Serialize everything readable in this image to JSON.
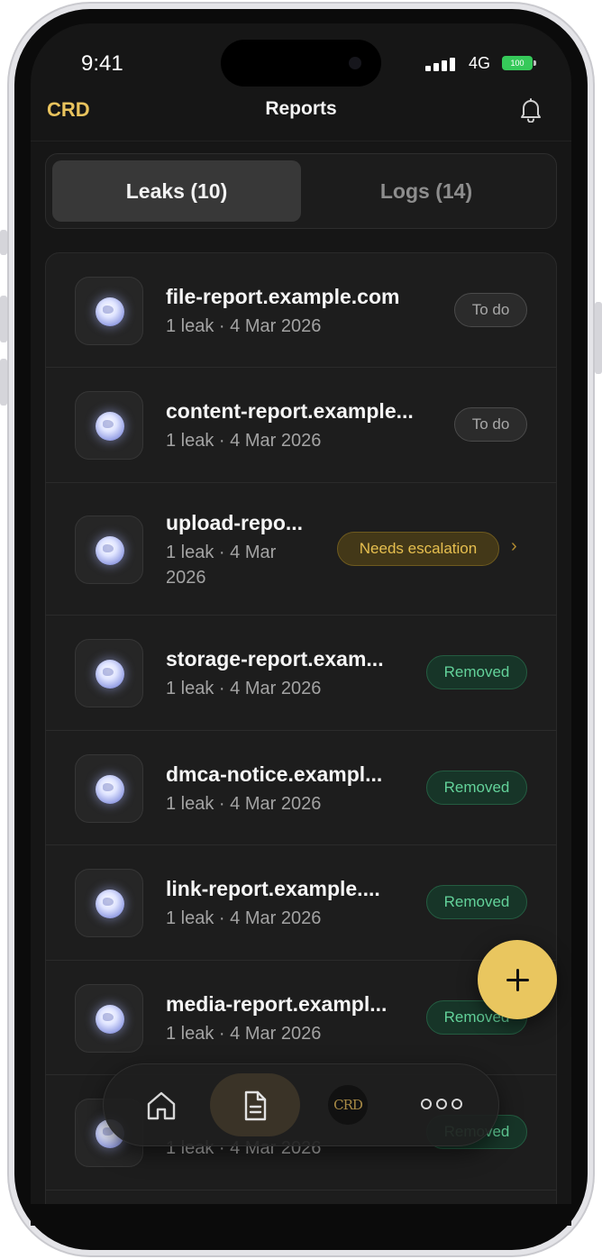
{
  "status": {
    "time": "9:41",
    "network": "4G",
    "battery": "100"
  },
  "header": {
    "brand": "CRD",
    "title": "Reports"
  },
  "tabs": [
    {
      "label": "Leaks (10)",
      "active": true
    },
    {
      "label": "Logs (14)",
      "active": false
    }
  ],
  "reports": [
    {
      "title": "file-report.example.com",
      "sub": "1 leak · 4 Mar 2026",
      "status": "To do"
    },
    {
      "title": "content-report.example...",
      "sub": "1 leak · 4 Mar 2026",
      "status": "To do"
    },
    {
      "title": "upload-repo...",
      "sub": "1 leak · 4 Mar 2026",
      "status": "Needs escalation"
    },
    {
      "title": "storage-report.exam...",
      "sub": "1 leak · 4 Mar 2026",
      "status": "Removed"
    },
    {
      "title": "dmca-notice.exampl...",
      "sub": "1 leak · 4 Mar 2026",
      "status": "Removed"
    },
    {
      "title": "link-report.example....",
      "sub": "1 leak · 4 Mar 2026",
      "status": "Removed"
    },
    {
      "title": "media-report.exampl...",
      "sub": "1 leak · 4 Mar 2026",
      "status": "Removed"
    },
    {
      "title": "",
      "sub": "1 leak · 4 Mar 2026",
      "status": "Removed"
    }
  ],
  "fab": {
    "icon": "plus-icon"
  },
  "tabbar": {
    "items": [
      {
        "icon": "home-icon",
        "active": false
      },
      {
        "icon": "document-icon",
        "active": true
      },
      {
        "icon": "crd-logo",
        "label": "CRD",
        "active": false
      },
      {
        "icon": "more-icon",
        "active": false
      }
    ]
  },
  "colors": {
    "accent": "#e9c65f",
    "background": "#161616",
    "removed": "#63d29a",
    "escalation": "#e6bf4f"
  }
}
